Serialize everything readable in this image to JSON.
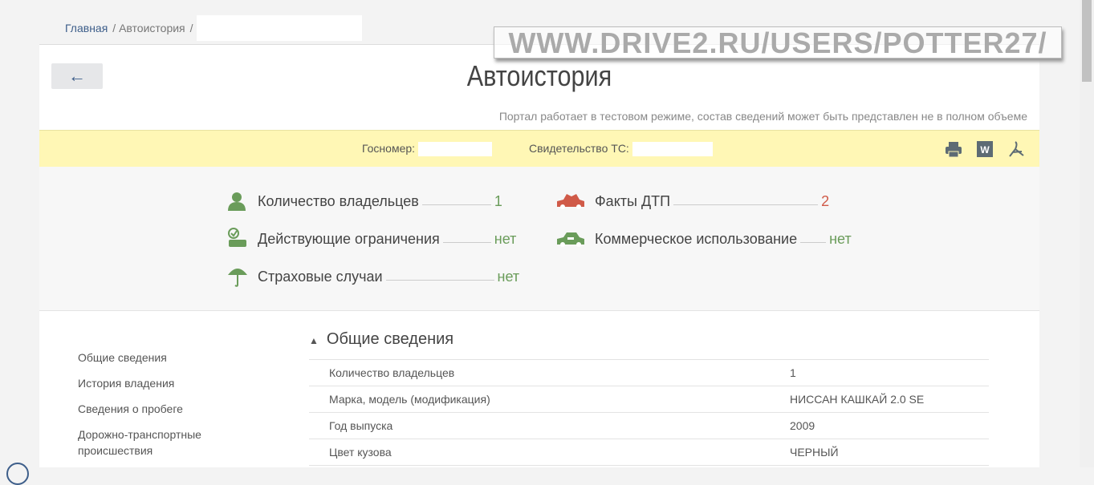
{
  "breadcrumb": {
    "home": "Главная",
    "section": "/ Автоистория",
    "sep": "/"
  },
  "watermark": "WWW.DRIVE2.RU/USERS/POTTER27/",
  "header": {
    "back_icon": "←",
    "title": "Автоистория",
    "note": "Портал работает в тестовом режиме, состав сведений может быть представлен не в полном объеме"
  },
  "info": {
    "plate_label": "Госномер:",
    "cert_label": "Свидетельство ТС:"
  },
  "stats": [
    {
      "label": "Количество владельцев",
      "value": "1",
      "color": "#6a9c5a"
    },
    {
      "label": "Действующие ограничения",
      "value": "нет",
      "color": "#6a9c5a"
    },
    {
      "label": "Страховые случаи",
      "value": "нет",
      "color": "#6a9c5a"
    },
    {
      "label": "Факты ДТП",
      "value": "2",
      "color": "#d05a48"
    },
    {
      "label": "Коммерческое использование",
      "value": "нет",
      "color": "#6a9c5a"
    }
  ],
  "sidebar": [
    "Общие сведения",
    "История владения",
    "Сведения о пробеге",
    "Дорожно-транспортные происшествия"
  ],
  "section": {
    "title": "Общие сведения",
    "rows": [
      {
        "label": "Количество владельцев",
        "value": "1"
      },
      {
        "label": "Марка, модель (модификация)",
        "value": "НИССАН КАШКАЙ 2.0 SE"
      },
      {
        "label": "Год выпуска",
        "value": "2009"
      },
      {
        "label": "Цвет кузова",
        "value": "ЧЕРНЫЙ"
      }
    ]
  }
}
